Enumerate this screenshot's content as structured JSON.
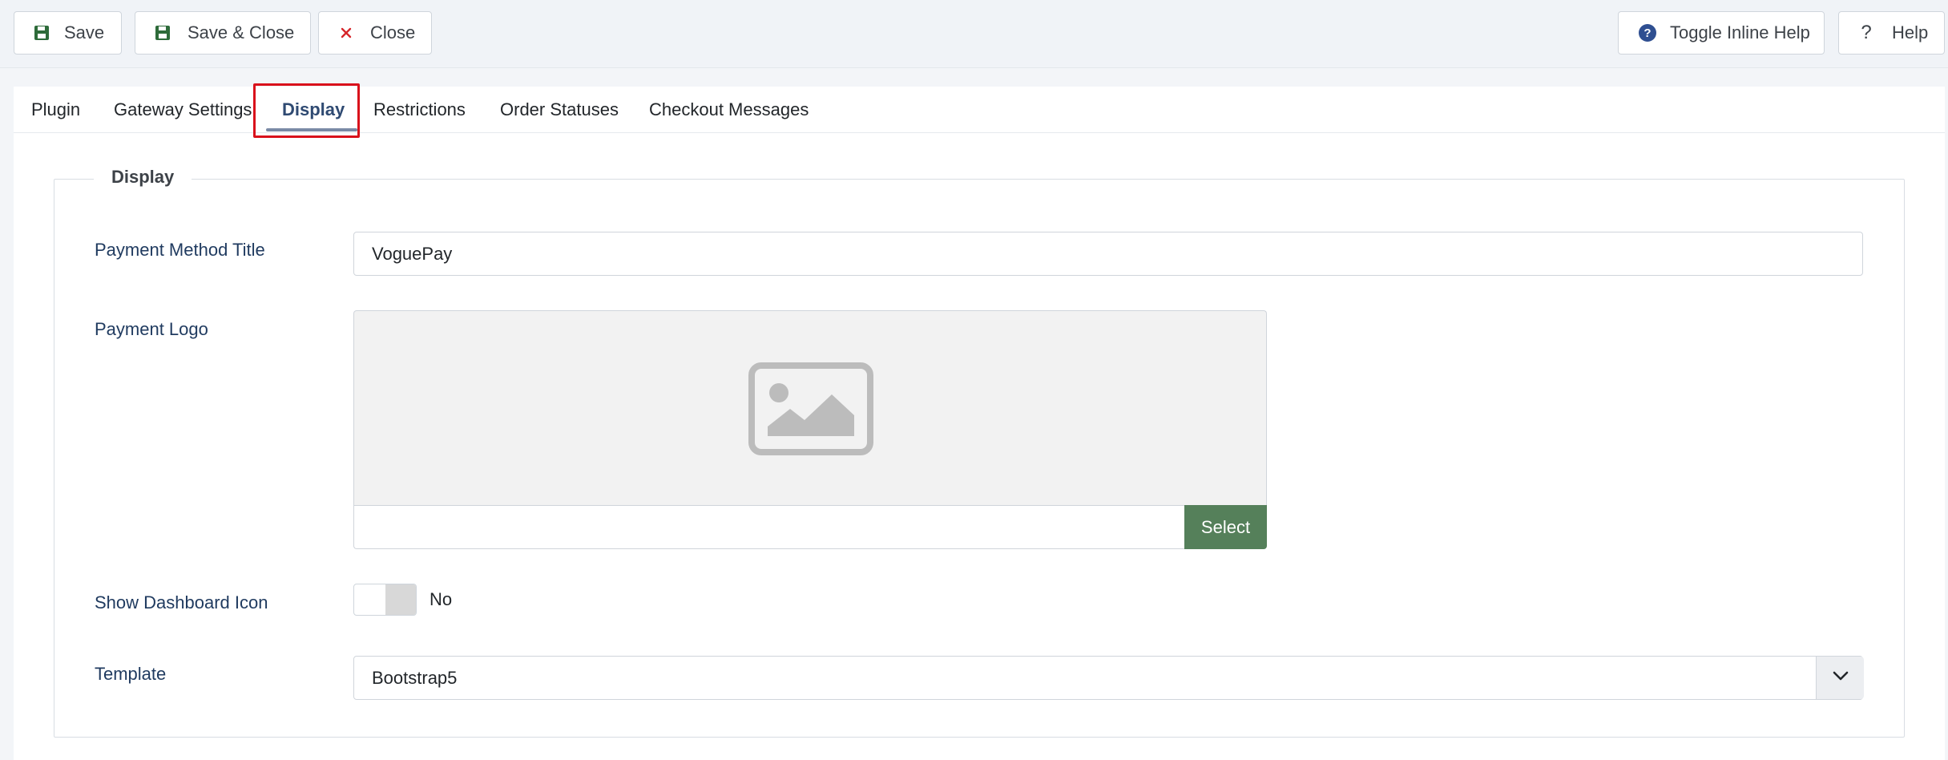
{
  "toolbar": {
    "save_label": "Save",
    "save_close_label": "Save & Close",
    "close_label": "Close",
    "toggle_help_label": "Toggle Inline Help",
    "help_label": "Help"
  },
  "tabs": [
    {
      "label": "Plugin"
    },
    {
      "label": "Gateway Settings"
    },
    {
      "label": "Display"
    },
    {
      "label": "Restrictions"
    },
    {
      "label": "Order Statuses"
    },
    {
      "label": "Checkout Messages"
    }
  ],
  "active_tab": "Display",
  "fieldset": {
    "legend": "Display",
    "payment_method_title": {
      "label": "Payment Method Title",
      "value": "VoguePay"
    },
    "payment_logo": {
      "label": "Payment Logo",
      "value": "",
      "select_label": "Select"
    },
    "show_dashboard_icon": {
      "label": "Show Dashboard Icon",
      "state": "No"
    },
    "template": {
      "label": "Template",
      "value": "Bootstrap5"
    }
  },
  "colors": {
    "accent_select": "#55805a",
    "active_tab": "#2f4a72",
    "highlight": "#d9111b",
    "label_text": "#1f3a5f"
  },
  "icons": {
    "save": "floppy-disk-icon",
    "save_close": "floppy-disk-icon",
    "close": "x-icon",
    "toggle_help": "question-circle-icon",
    "help": "question-mark-icon",
    "logo_placeholder": "image-placeholder-icon",
    "template_caret": "chevron-down-icon"
  }
}
